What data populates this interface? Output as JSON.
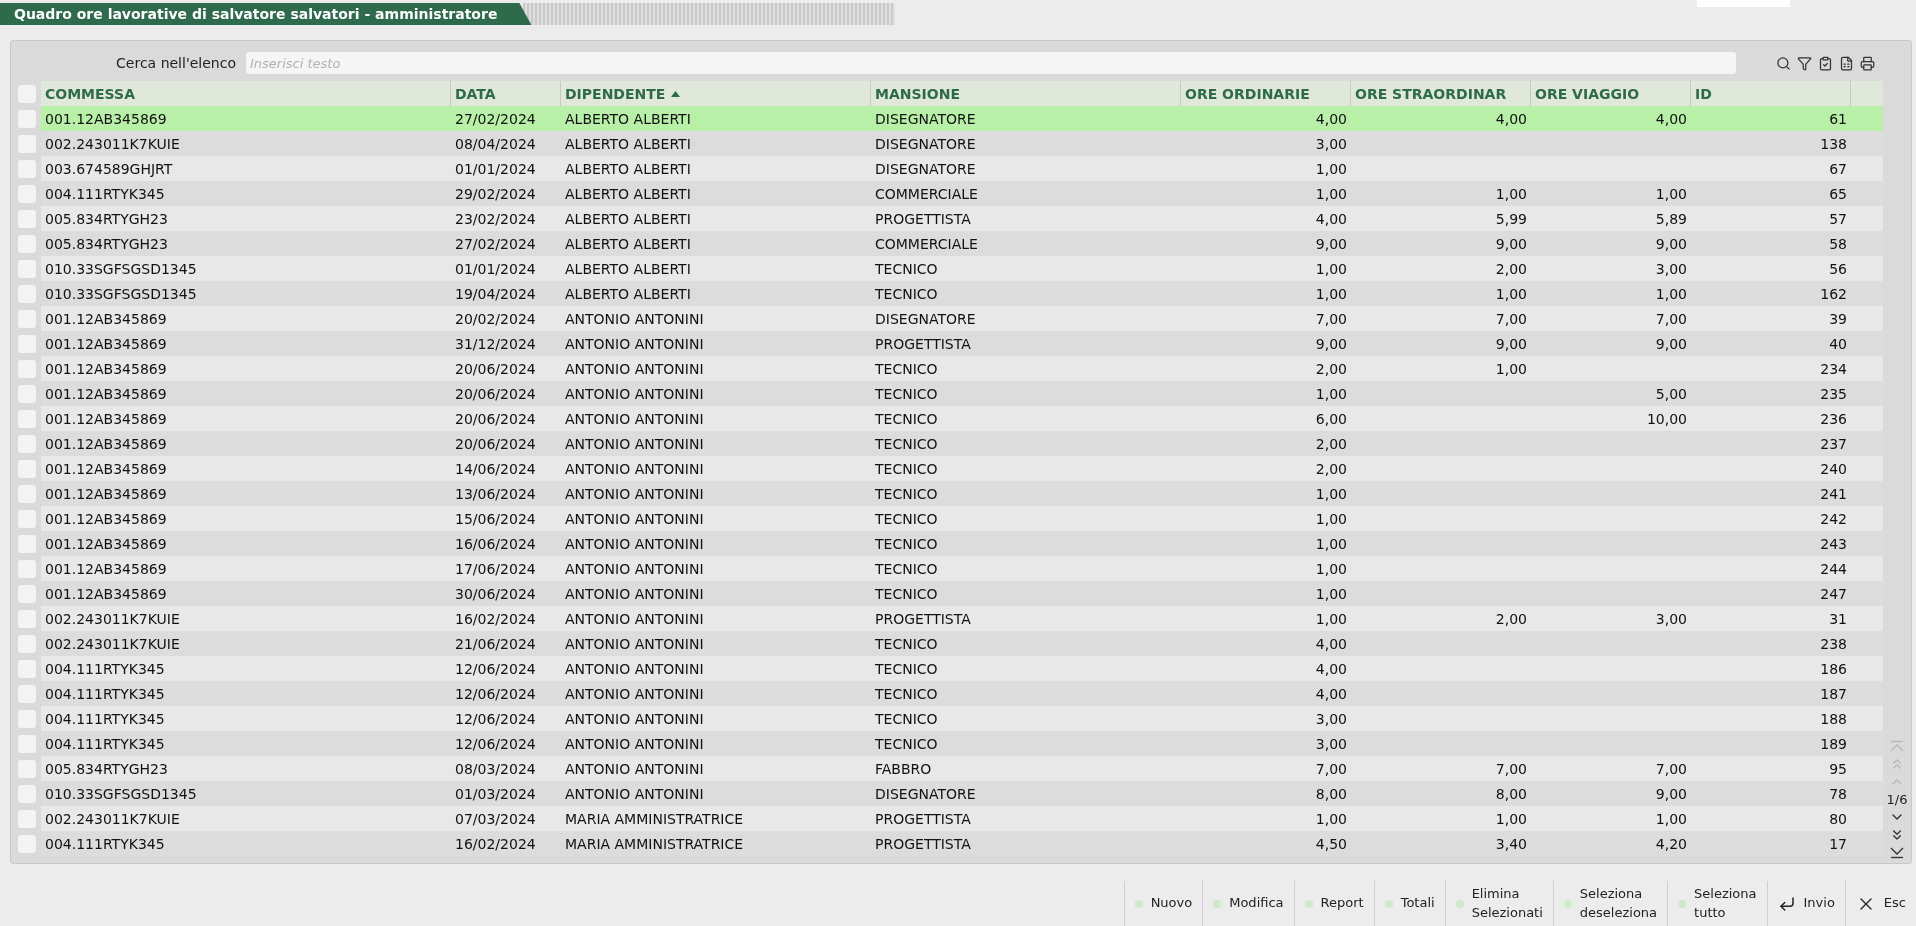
{
  "window": {
    "title": "Quadro ore lavorative di salvatore salvatori - amministratore"
  },
  "search": {
    "label": "Cerca nell'elenco",
    "placeholder": "Inserisci testo"
  },
  "table": {
    "columns": [
      {
        "kind": "text",
        "label": "COMMESSA",
        "sorted": false
      },
      {
        "kind": "text",
        "label": "DATA",
        "sorted": false
      },
      {
        "kind": "text",
        "label": "DIPENDENTE",
        "sorted": true
      },
      {
        "kind": "text",
        "label": "MANSIONE",
        "sorted": false
      },
      {
        "kind": "number",
        "label": "ORE ORDINARIE",
        "sorted": false
      },
      {
        "kind": "number",
        "label": "ORE STRAORDINAR",
        "sorted": false
      },
      {
        "kind": "number",
        "label": "ORE VIAGGIO",
        "sorted": false
      },
      {
        "kind": "number",
        "label": "ID",
        "sorted": false
      }
    ],
    "all_checked": false,
    "rows": [
      {
        "selected": true,
        "checked": false,
        "commessa": "001.12AB345869",
        "data": "27/02/2024",
        "dipendente": "ALBERTO ALBERTI",
        "mansione": "DISEGNATORE",
        "ore_ordinarie": "4,00",
        "ore_straordinarie": "4,00",
        "ore_viaggio": "4,00",
        "id": "61"
      },
      {
        "selected": false,
        "checked": false,
        "commessa": "002.243011K7KUIE",
        "data": "08/04/2024",
        "dipendente": "ALBERTO ALBERTI",
        "mansione": "DISEGNATORE",
        "ore_ordinarie": "3,00",
        "id": "138"
      },
      {
        "selected": false,
        "checked": false,
        "commessa": "003.674589GHJRT",
        "data": "01/01/2024",
        "dipendente": "ALBERTO ALBERTI",
        "mansione": "DISEGNATORE",
        "ore_ordinarie": "1,00",
        "id": "67"
      },
      {
        "selected": false,
        "checked": false,
        "commessa": "004.111RTYK345",
        "data": "29/02/2024",
        "dipendente": "ALBERTO ALBERTI",
        "mansione": "COMMERCIALE",
        "ore_ordinarie": "1,00",
        "ore_straordinarie": "1,00",
        "ore_viaggio": "1,00",
        "id": "65"
      },
      {
        "selected": false,
        "checked": false,
        "commessa": "005.834RTYGH23",
        "data": "23/02/2024",
        "dipendente": "ALBERTO ALBERTI",
        "mansione": "PROGETTISTA",
        "ore_ordinarie": "4,00",
        "ore_straordinarie": "5,99",
        "ore_viaggio": "5,89",
        "id": "57"
      },
      {
        "selected": false,
        "checked": false,
        "commessa": "005.834RTYGH23",
        "data": "27/02/2024",
        "dipendente": "ALBERTO ALBERTI",
        "mansione": "COMMERCIALE",
        "ore_ordinarie": "9,00",
        "ore_straordinarie": "9,00",
        "ore_viaggio": "9,00",
        "id": "58"
      },
      {
        "selected": false,
        "checked": false,
        "commessa": "010.33SGFSGSD1345",
        "data": "01/01/2024",
        "dipendente": "ALBERTO ALBERTI",
        "mansione": "TECNICO",
        "ore_ordinarie": "1,00",
        "ore_straordinarie": "2,00",
        "ore_viaggio": "3,00",
        "id": "56"
      },
      {
        "selected": false,
        "checked": false,
        "commessa": "010.33SGFSGSD1345",
        "data": "19/04/2024",
        "dipendente": "ALBERTO ALBERTI",
        "mansione": "TECNICO",
        "ore_ordinarie": "1,00",
        "ore_straordinarie": "1,00",
        "ore_viaggio": "1,00",
        "id": "162"
      },
      {
        "selected": false,
        "checked": false,
        "commessa": "001.12AB345869",
        "data": "20/02/2024",
        "dipendente": "ANTONIO ANTONINI",
        "mansione": "DISEGNATORE",
        "ore_ordinarie": "7,00",
        "ore_straordinarie": "7,00",
        "ore_viaggio": "7,00",
        "id": "39"
      },
      {
        "selected": false,
        "checked": false,
        "commessa": "001.12AB345869",
        "data": "31/12/2024",
        "dipendente": "ANTONIO ANTONINI",
        "mansione": "PROGETTISTA",
        "ore_ordinarie": "9,00",
        "ore_straordinarie": "9,00",
        "ore_viaggio": "9,00",
        "id": "40"
      },
      {
        "selected": false,
        "checked": false,
        "commessa": "001.12AB345869",
        "data": "20/06/2024",
        "dipendente": "ANTONIO ANTONINI",
        "mansione": "TECNICO",
        "ore_ordinarie": "2,00",
        "ore_straordinarie": "1,00",
        "id": "234"
      },
      {
        "selected": false,
        "checked": false,
        "commessa": "001.12AB345869",
        "data": "20/06/2024",
        "dipendente": "ANTONIO ANTONINI",
        "mansione": "TECNICO",
        "ore_ordinarie": "1,00",
        "ore_viaggio": "5,00",
        "id": "235"
      },
      {
        "selected": false,
        "checked": false,
        "commessa": "001.12AB345869",
        "data": "20/06/2024",
        "dipendente": "ANTONIO ANTONINI",
        "mansione": "TECNICO",
        "ore_ordinarie": "6,00",
        "ore_viaggio": "10,00",
        "id": "236"
      },
      {
        "selected": false,
        "checked": false,
        "commessa": "001.12AB345869",
        "data": "20/06/2024",
        "dipendente": "ANTONIO ANTONINI",
        "mansione": "TECNICO",
        "ore_ordinarie": "2,00",
        "id": "237"
      },
      {
        "selected": false,
        "checked": false,
        "commessa": "001.12AB345869",
        "data": "14/06/2024",
        "dipendente": "ANTONIO ANTONINI",
        "mansione": "TECNICO",
        "ore_ordinarie": "2,00",
        "id": "240"
      },
      {
        "selected": false,
        "checked": false,
        "commessa": "001.12AB345869",
        "data": "13/06/2024",
        "dipendente": "ANTONIO ANTONINI",
        "mansione": "TECNICO",
        "ore_ordinarie": "1,00",
        "id": "241"
      },
      {
        "selected": false,
        "checked": false,
        "commessa": "001.12AB345869",
        "data": "15/06/2024",
        "dipendente": "ANTONIO ANTONINI",
        "mansione": "TECNICO",
        "ore_ordinarie": "1,00",
        "id": "242"
      },
      {
        "selected": false,
        "checked": false,
        "commessa": "001.12AB345869",
        "data": "16/06/2024",
        "dipendente": "ANTONIO ANTONINI",
        "mansione": "TECNICO",
        "ore_ordinarie": "1,00",
        "id": "243"
      },
      {
        "selected": false,
        "checked": false,
        "commessa": "001.12AB345869",
        "data": "17/06/2024",
        "dipendente": "ANTONIO ANTONINI",
        "mansione": "TECNICO",
        "ore_ordinarie": "1,00",
        "id": "244"
      },
      {
        "selected": false,
        "checked": false,
        "commessa": "001.12AB345869",
        "data": "30/06/2024",
        "dipendente": "ANTONIO ANTONINI",
        "mansione": "TECNICO",
        "ore_ordinarie": "1,00",
        "id": "247"
      },
      {
        "selected": false,
        "checked": false,
        "commessa": "002.243011K7KUIE",
        "data": "16/02/2024",
        "dipendente": "ANTONIO ANTONINI",
        "mansione": "PROGETTISTA",
        "ore_ordinarie": "1,00",
        "ore_straordinarie": "2,00",
        "ore_viaggio": "3,00",
        "id": "31"
      },
      {
        "selected": false,
        "checked": false,
        "commessa": "002.243011K7KUIE",
        "data": "21/06/2024",
        "dipendente": "ANTONIO ANTONINI",
        "mansione": "TECNICO",
        "ore_ordinarie": "4,00",
        "id": "238"
      },
      {
        "selected": false,
        "checked": false,
        "commessa": "004.111RTYK345",
        "data": "12/06/2024",
        "dipendente": "ANTONIO ANTONINI",
        "mansione": "TECNICO",
        "ore_ordinarie": "4,00",
        "id": "186"
      },
      {
        "selected": false,
        "checked": false,
        "commessa": "004.111RTYK345",
        "data": "12/06/2024",
        "dipendente": "ANTONIO ANTONINI",
        "mansione": "TECNICO",
        "ore_ordinarie": "4,00",
        "id": "187"
      },
      {
        "selected": false,
        "checked": false,
        "commessa": "004.111RTYK345",
        "data": "12/06/2024",
        "dipendente": "ANTONIO ANTONINI",
        "mansione": "TECNICO",
        "ore_ordinarie": "3,00",
        "id": "188"
      },
      {
        "selected": false,
        "checked": false,
        "commessa": "004.111RTYK345",
        "data": "12/06/2024",
        "dipendente": "ANTONIO ANTONINI",
        "mansione": "TECNICO",
        "ore_ordinarie": "3,00",
        "id": "189"
      },
      {
        "selected": false,
        "checked": false,
        "commessa": "005.834RTYGH23",
        "data": "08/03/2024",
        "dipendente": "ANTONIO ANTONINI",
        "mansione": "FABBRO",
        "ore_ordinarie": "7,00",
        "ore_straordinarie": "7,00",
        "ore_viaggio": "7,00",
        "id": "95"
      },
      {
        "selected": false,
        "checked": false,
        "commessa": "010.33SGFSGSD1345",
        "data": "01/03/2024",
        "dipendente": "ANTONIO ANTONINI",
        "mansione": "DISEGNATORE",
        "ore_ordinarie": "8,00",
        "ore_straordinarie": "8,00",
        "ore_viaggio": "9,00",
        "id": "78"
      },
      {
        "selected": false,
        "checked": false,
        "commessa": "002.243011K7KUIE",
        "data": "07/03/2024",
        "dipendente": "MARIA AMMINISTRATRICE",
        "mansione": "PROGETTISTA",
        "ore_ordinarie": "1,00",
        "ore_straordinarie": "1,00",
        "ore_viaggio": "1,00",
        "id": "80"
      },
      {
        "selected": false,
        "checked": false,
        "commessa": "004.111RTYK345",
        "data": "16/02/2024",
        "dipendente": "MARIA AMMINISTRATRICE",
        "mansione": "PROGETTISTA",
        "ore_ordinarie": "4,50",
        "ore_straordinarie": "3,40",
        "ore_viaggio": "4,20",
        "id": "17"
      }
    ]
  },
  "pager": {
    "page": "1/6",
    "at_start": true,
    "at_end": false
  },
  "buttons": [
    {
      "kind": "dot",
      "label": "Nuovo"
    },
    {
      "kind": "dot",
      "label": "Modifica"
    },
    {
      "kind": "dot",
      "label": "Report"
    },
    {
      "kind": "dot",
      "label": "Totali"
    },
    {
      "kind": "dot",
      "label": "Elimina\nSelezionati"
    },
    {
      "kind": "dot",
      "label": "Seleziona\ndeseleziona"
    },
    {
      "kind": "dot",
      "label": "Seleziona\ntutto"
    },
    {
      "kind": "enter",
      "label": "Invio"
    },
    {
      "kind": "close",
      "label": "Esc"
    }
  ]
}
